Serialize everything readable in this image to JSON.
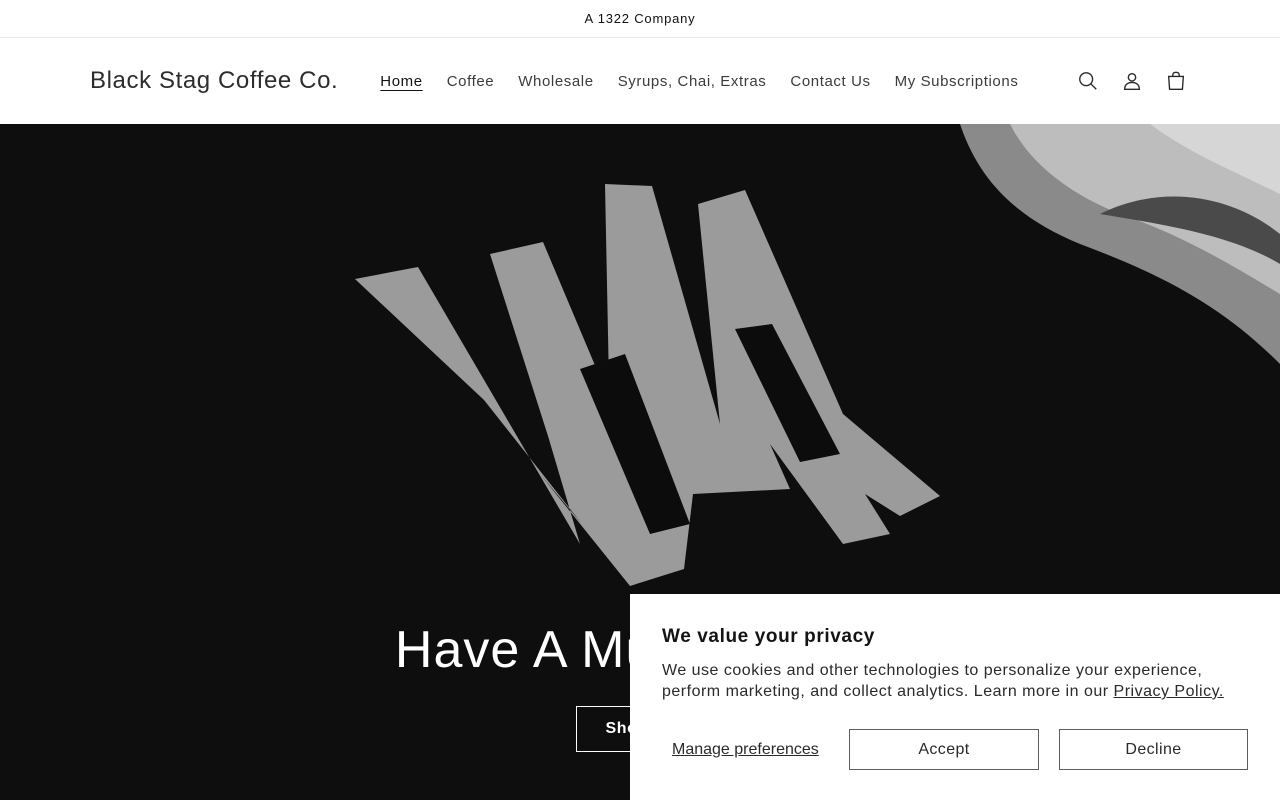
{
  "announcement": {
    "text": "A 1322 Company"
  },
  "header": {
    "logo": "Black Stag Coffee Co.",
    "nav": [
      {
        "label": "Home",
        "active": true
      },
      {
        "label": "Coffee"
      },
      {
        "label": "Wholesale"
      },
      {
        "label": "Syrups, Chai, Extras"
      },
      {
        "label": "Contact Us"
      },
      {
        "label": "My Subscriptions"
      }
    ],
    "icons": [
      "search-icon",
      "account-icon",
      "cart-icon"
    ]
  },
  "hero": {
    "title": "Have A Mug About It",
    "button_label": "Shop All"
  },
  "cookie_banner": {
    "title": "We value your privacy",
    "text": "We use cookies and other technologies to personalize your experience, perform marketing, and collect analytics. Learn more in our ",
    "link_label": "Privacy Policy.",
    "manage_label": "Manage preferences",
    "accept_label": "Accept",
    "decline_label": "Decline"
  }
}
